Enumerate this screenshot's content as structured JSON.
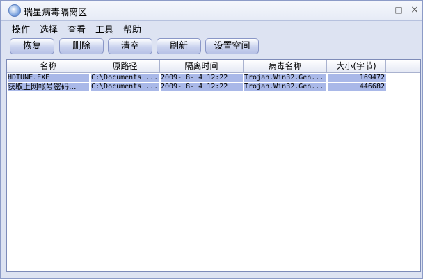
{
  "window": {
    "title": "瑞星病毒隔离区"
  },
  "window_controls": {
    "minimize": "–",
    "maximize": "□",
    "close": "×"
  },
  "menu": [
    "操作",
    "选择",
    "查看",
    "工具",
    "帮助"
  ],
  "toolbar": [
    "恢复",
    "删除",
    "清空",
    "刷新",
    "设置空间"
  ],
  "table": {
    "columns": [
      "名称",
      "原路径",
      "隔离时间",
      "病毒名称",
      "大小(字节)"
    ],
    "rows": [
      [
        "HDTUNE.EXE",
        "C:\\Documents ...",
        "2009- 8- 4 12:22",
        "Trojan.Win32.Gen...",
        "169472"
      ],
      [
        "获取上网帐号密码...",
        "C:\\Documents ...",
        "2009- 8- 4 12:22",
        "Trojan.Win32.Gen...",
        "446682"
      ]
    ]
  }
}
